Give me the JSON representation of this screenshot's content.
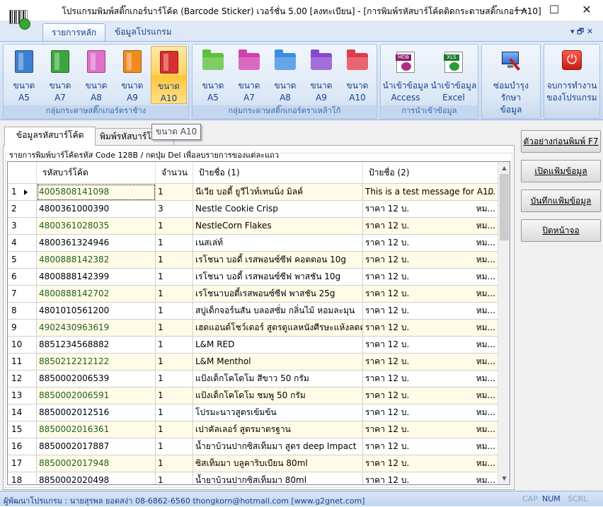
{
  "window": {
    "title": "โปรแกรมพิมพ์สติ๊กเกอร์บาร์โค้ด (Barcode Sticker) เวอร์ชั่น 5.00 [ลงทะเบียน] - [การพิมพ์รหัสบาร์โค้ดติดกระดาษสติ๊กเกอร์ A10]",
    "minimize": "—",
    "maximize": "☐",
    "close": "✕"
  },
  "ribbon_tabs": {
    "main": "รายการหลัก",
    "info": "ข้อมูลโปรแกรม",
    "mdi": "▾  🗗  ✕"
  },
  "ribbon": {
    "group1": {
      "label": "กลุ่มกระดาษสติ๊กเกอร์ตราช้าง",
      "buttons": [
        "ขนาด\nA5",
        "ขนาด\nA7",
        "ขนาด\nA8",
        "ขนาด\nA9",
        "ขนาด\nA10"
      ],
      "colors": [
        "#3d7fd0",
        "#3ca63c",
        "#e070c8",
        "#f08a20",
        "#d83030"
      ]
    },
    "group2": {
      "label": "กลุ่มกระดาษสติ๊กเกอร์ตราเหล้าโก้",
      "buttons": [
        "ขนาด\nA5",
        "ขนาด\nA7",
        "ขนาด\nA8",
        "ขนาด\nA9",
        "ขนาด\nA10"
      ],
      "colors": [
        "#5cc03a",
        "#d040b0",
        "#3a8ee0",
        "#8a48d0",
        "#e03a4a"
      ]
    },
    "group3": {
      "label": "การนำเข้าข้อมูล",
      "access": "นำเข้าข้อมูล\nAccess",
      "excel": "นำเข้าข้อมูล\nExcel",
      "access_tag": "MDB",
      "excel_tag": "XLS"
    },
    "group4": {
      "repair": "ซ่อมบำรุงรักษา\nข้อมูล"
    },
    "group5": {
      "exit": "จบการทำงาน\nของโปรแกรม",
      "power_glyph": "⏻"
    }
  },
  "tooltip": "ขนาด A10",
  "content_tabs": {
    "barcode_data": "ข้อมูลรหัสบาร์โค้ด",
    "print_barcode": "พิมพ์รหัสบาร์โค้ด"
  },
  "panel_caption": "รายการพิมพ์บาร์โค้ดรหัส Code 128B / กดปุ่ม Del เพื่อลบรายการของแต่ละแถว",
  "grid": {
    "columns": [
      "รหัสบาร์โค้ด",
      "จำนวน",
      "ป้ายชื่อ (1)",
      "ป้ายชื่อ (2)"
    ],
    "rows": [
      {
        "no": "1",
        "code": "4005808141098",
        "qty": "1",
        "label1": "นีเวีย บอดี้ ยูวีไวท์เทนนิ่ง  มิลค์",
        "label2": "This is a test message for A10",
        "trail": "..."
      },
      {
        "no": "2",
        "code": "4800361000390",
        "qty": "3",
        "label1": "Nestle Cookie Crisp",
        "label2": "ราคา 12 บ.",
        "trail": "หม..."
      },
      {
        "no": "3",
        "code": "4800361028035",
        "qty": "1",
        "label1": "NestleCorn Flakes",
        "label2": "ราคา 12 บ.",
        "trail": "หม..."
      },
      {
        "no": "4",
        "code": "4800361324946",
        "qty": "1",
        "label1": "เนสเล่ท์",
        "label2": "ราคา 12 บ.",
        "trail": "หม..."
      },
      {
        "no": "5",
        "code": "4800888142382",
        "qty": "1",
        "label1": "เรโชนา บอดี้ เรสพอนซ์ซีฟ คอตตอน 10g",
        "label2": "ราคา 12 บ.",
        "trail": "หม..."
      },
      {
        "no": "6",
        "code": "4800888142399",
        "qty": "1",
        "label1": "เรโชนา บอดี้ เรสพอนซ์ซีฟ พาสชัน  10g",
        "label2": "ราคา 12 บ.",
        "trail": "หม..."
      },
      {
        "no": "7",
        "code": "4800888142702",
        "qty": "1",
        "label1": "เรโชนาบอดี้เรสพอนซ์ซีฟ พาสชัน  25g",
        "label2": "ราคา 12 บ.",
        "trail": "หม..."
      },
      {
        "no": "8",
        "code": "4801010561200",
        "qty": "1",
        "label1": "สบู่เด็กจอร์นสัน บลอสซั่ม กลิ่นไม้  หอมละมุน",
        "label2": "ราคา 12 บ.",
        "trail": "หม..."
      },
      {
        "no": "9",
        "code": "4902430963619",
        "qty": "1",
        "label1": "เฮดแอนด์โชว์เดอร์  สูตรดูแลหนังศีรษะแห้งลดค...",
        "label2": "ราคา 12 บ.",
        "trail": "หม..."
      },
      {
        "no": "10",
        "code": "8851234568882",
        "qty": "1",
        "label1": "L&M RED",
        "label2": "ราคา 12 บ.",
        "trail": "หม..."
      },
      {
        "no": "11",
        "code": "8850212212122",
        "qty": "1",
        "label1": "L&M Menthol",
        "label2": "ราคา 12 บ.",
        "trail": "หม..."
      },
      {
        "no": "12",
        "code": "8850002006539",
        "qty": "1",
        "label1": "แป้งเด็กโคโดโม สีขาว 50 กรัม",
        "label2": "ราคา 12 บ.",
        "trail": "หม..."
      },
      {
        "no": "13",
        "code": "8850002006591",
        "qty": "1",
        "label1": "แป้งเด็กโคโดโม  ชมพู 50 กรัม",
        "label2": "ราคา 12 บ.",
        "trail": "หม..."
      },
      {
        "no": "14",
        "code": "8850002012516",
        "qty": "1",
        "label1": "โปรมะนาวสูตรเข้มข้น",
        "label2": "ราคา 12 บ.",
        "trail": "หม..."
      },
      {
        "no": "15",
        "code": "8850002016361",
        "qty": "1",
        "label1": "เปาคัลเลอร์ สูตรมาตรฐาน",
        "label2": "ราคา 12 บ.",
        "trail": "หม..."
      },
      {
        "no": "16",
        "code": "8850002017887",
        "qty": "1",
        "label1": "น้ำยาบ้วนปากซิสเท็มมา  สูตร deep Impact",
        "label2": "ราคา 12 บ.",
        "trail": "หม..."
      },
      {
        "no": "17",
        "code": "8850002017948",
        "qty": "1",
        "label1": "ซิสเท็มมา บลูคาริบเบียน  80ml",
        "label2": "ราคา 12 บ.",
        "trail": "หม..."
      },
      {
        "no": "18",
        "code": "8850002020498",
        "qty": "1",
        "label1": "น้ำยาบ้วนปากซิสเท็มมา  80ml",
        "label2": "ราคา 12 บ.",
        "trail": "หม..."
      }
    ]
  },
  "side_buttons": {
    "preview": "ตัวอย่างก่อนพิมพ์ F7",
    "open": "เปิดแฟ้มข้อมูล",
    "save": "บันทึกแฟ้มข้อมูล",
    "close": "ปิดหน้าจอ"
  },
  "statusbar": {
    "text": "ผู้พัฒนาโปรแกรม : นายสุรพล ยอดสง่า 08-6862-6560 thongkorn@hotmail.com [www.g2gnet.com]",
    "cap": "CAP",
    "num": "NUM",
    "scrl": "SCRL"
  },
  "colors": {
    "row_alt": "#fffbe6",
    "code_green": "#206020",
    "ribbon_text": "#15428b"
  }
}
